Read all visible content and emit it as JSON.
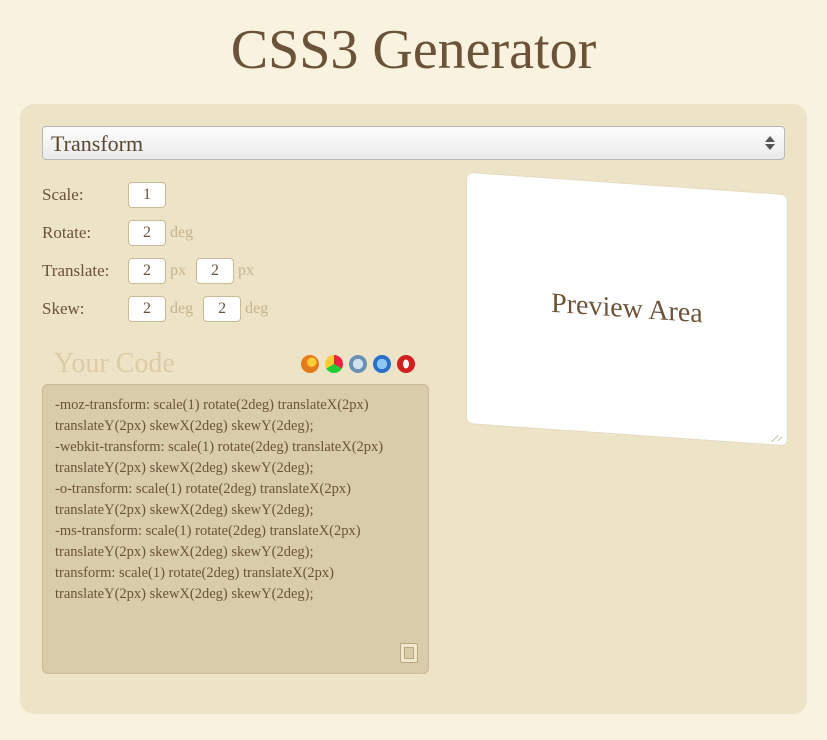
{
  "title": "CSS3 Generator",
  "dropdown": {
    "selected": "Transform"
  },
  "form": {
    "scale": {
      "label": "Scale:",
      "value": "1"
    },
    "rotate": {
      "label": "Rotate:",
      "value": "2",
      "unit": "deg"
    },
    "translate": {
      "label": "Translate:",
      "x": "2",
      "y": "2",
      "unit": "px"
    },
    "skew": {
      "label": "Skew:",
      "x": "2",
      "y": "2",
      "unit": "deg"
    }
  },
  "code": {
    "title": "Your Code",
    "text": "-moz-transform: scale(1) rotate(2deg) translateX(2px) translateY(2px) skewX(2deg) skewY(2deg);\n-webkit-transform: scale(1) rotate(2deg) translateX(2px) translateY(2px) skewX(2deg) skewY(2deg);\n-o-transform: scale(1) rotate(2deg) translateX(2px) translateY(2px) skewX(2deg) skewY(2deg);\n-ms-transform: scale(1) rotate(2deg) translateX(2px) translateY(2px) skewX(2deg) skewY(2deg);\ntransform: scale(1) rotate(2deg) translateX(2px) translateY(2px) skewX(2deg) skewY(2deg);"
  },
  "preview": {
    "label": "Preview Area"
  },
  "browsers": {
    "firefox": "#e37b1c",
    "chrome_outer": "conic-gradient(#e24 0 120deg,#2c3 120deg 240deg,#fc3 240deg 360deg)",
    "safari": "#6b8fb5",
    "ie": "#2a6fc9",
    "opera": "#d21f1f"
  }
}
